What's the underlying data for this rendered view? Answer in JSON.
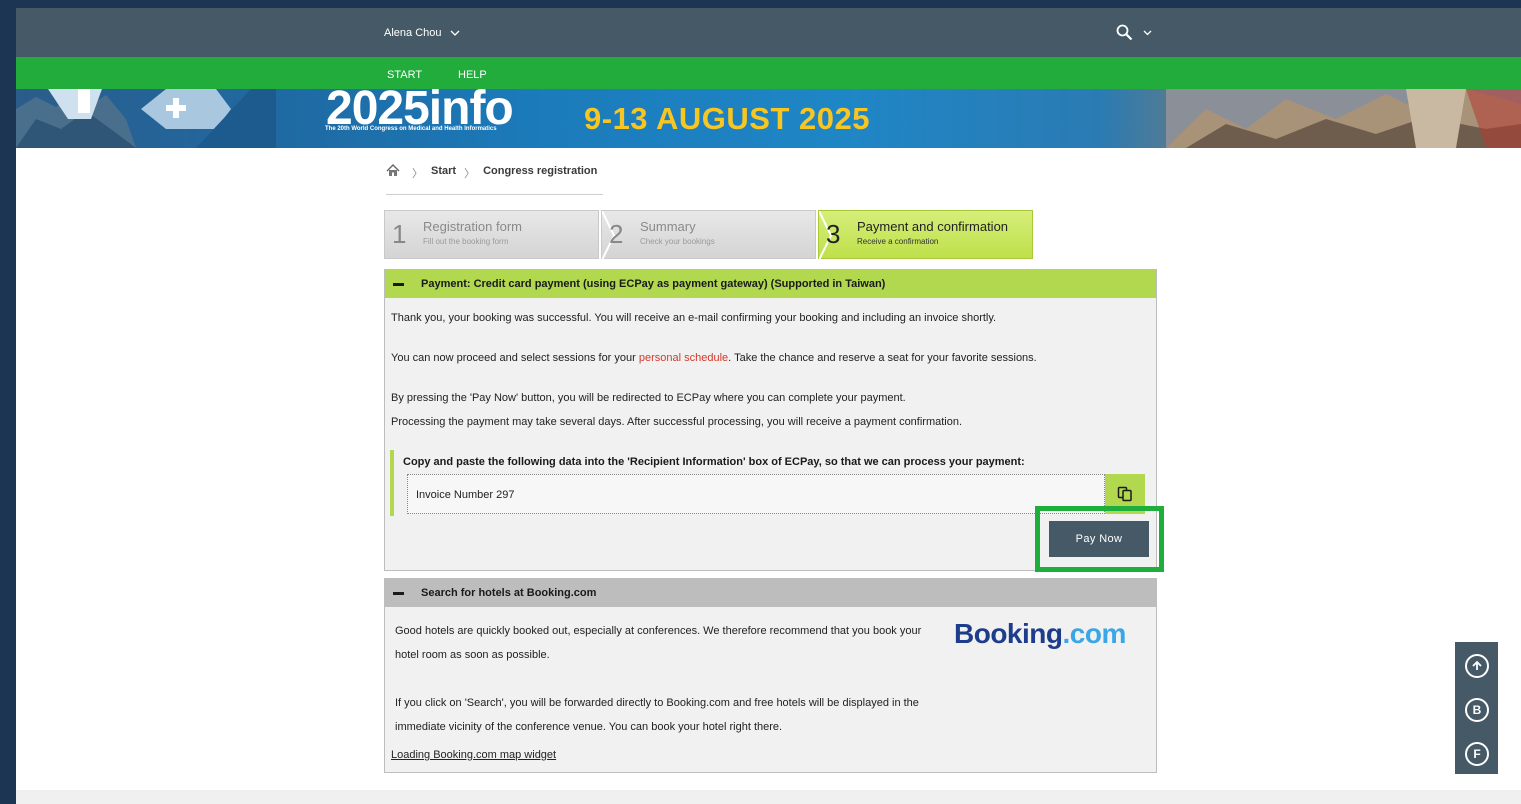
{
  "header": {
    "user_name": "Alena Chou",
    "user_menu_icon": "chevron-down-icon",
    "search_icon": "search-icon"
  },
  "nav": {
    "items": [
      {
        "label": "START"
      },
      {
        "label": "HELP"
      }
    ]
  },
  "banner": {
    "logo_text": "2025info",
    "congress_name": "The 20th World Congress on Medical and Health Informatics",
    "dates": "9-13 AUGUST 2025"
  },
  "breadcrumb": {
    "home_icon": "home-icon",
    "items": [
      {
        "label": "Start"
      },
      {
        "label": "Congress registration"
      }
    ]
  },
  "steps": [
    {
      "number": "1",
      "title": "Registration form",
      "subtitle": "Fill out the booking form",
      "active": false
    },
    {
      "number": "2",
      "title": "Summary",
      "subtitle": "Check your bookings",
      "active": false
    },
    {
      "number": "3",
      "title": "Payment and confirmation",
      "subtitle": "Receive a confirmation",
      "active": true
    }
  ],
  "payment_panel": {
    "title": "Payment: Credit card payment (using ECPay as payment gateway) (Supported in Taiwan)",
    "thank_you": "Thank you, your booking was successful. You will receive an e-mail confirming your booking and including an invoice shortly.",
    "schedule_prefix": "You can now proceed and select sessions for your ",
    "schedule_link": "personal schedule",
    "schedule_suffix": ". Take the chance and reserve a seat for your favorite sessions.",
    "redirect_text": "By pressing the 'Pay Now' button, you will be redirected to ECPay where you can complete your payment.",
    "processing_text": "Processing the payment may take several days. After successful processing, you will receive a payment confirmation.",
    "copy_label": "Copy and paste the following data into the 'Recipient Information' box of ECPay, so that we can process your payment:",
    "invoice_value": "Invoice Number 297",
    "copy_icon": "copy-icon",
    "pay_now_label": "Pay Now"
  },
  "hotel_panel": {
    "title": "Search for hotels at Booking.com",
    "line1": "Good hotels are quickly booked out, especially at conferences. We therefore recommend that you book your",
    "line2": "hotel room as soon as possible.",
    "line3": "If you click on 'Search', you will be forwarded directly to Booking.com and free hotels will be displayed in the",
    "line4": "immediate vicinity of the conference venue. You can book your hotel right there.",
    "logo_part1": "Booking",
    "logo_part2": ".com",
    "map_link": "Loading Booking.com map widget"
  },
  "floating_tools": {
    "up_icon": "arrow-up-circle-icon",
    "b_label": "B",
    "f_label": "F"
  },
  "colors": {
    "topbar": "#455a66",
    "navbar": "#21ac3c",
    "accent_green": "#b2d84f",
    "highlight": "#1fae3c",
    "link_red": "#d23a2b"
  }
}
